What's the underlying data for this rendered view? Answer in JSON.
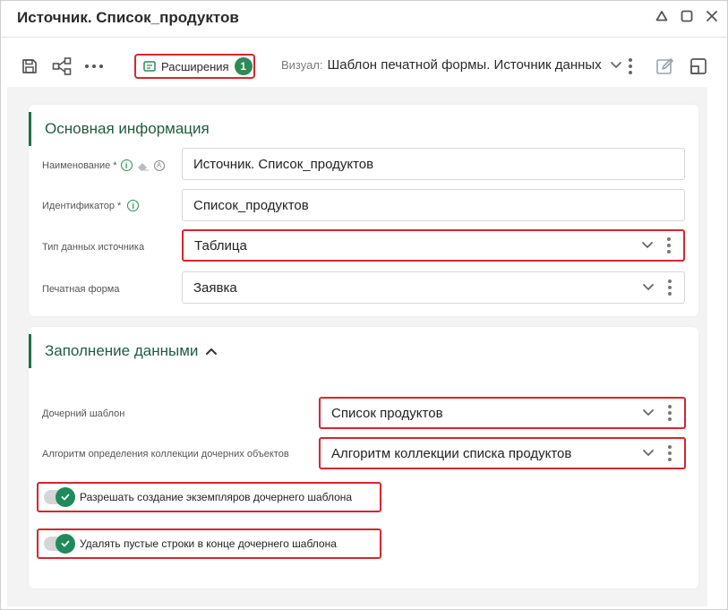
{
  "window": {
    "title": "Источник. Список_продуктов"
  },
  "toolbar": {
    "extensions_label": "Расширения",
    "extensions_count": "1",
    "visual_label": "Визуал:",
    "visual_value": "Шаблон печатной формы. Источник данных"
  },
  "section_main": {
    "title": "Основная информация",
    "fields": [
      {
        "label": "Наименование *",
        "value": "Источник. Список_продуктов"
      },
      {
        "label": "Идентификатор *",
        "value": "Список_продуктов"
      },
      {
        "label": "Тип данных источника",
        "value": "Таблица"
      },
      {
        "label": "Печатная форма",
        "value": "Заявка"
      }
    ]
  },
  "section_fill": {
    "title": "Заполнение данными",
    "fields": [
      {
        "label": "Дочерний шаблон",
        "value": "Список продуктов"
      },
      {
        "label": "Алгоритм определения коллекции дочерних объектов",
        "value": "Алгоритм коллекции списка продуктов"
      }
    ],
    "toggles": [
      {
        "label": "Разрешать создание экземпляров дочернего шаблона",
        "checked": true
      },
      {
        "label": "Удалять пустые строки в конце дочернего шаблона",
        "checked": true
      }
    ]
  },
  "colors": {
    "accent_green": "#1f8a5a",
    "highlight_red": "#d7262f",
    "section_title": "#1f5c3f"
  }
}
